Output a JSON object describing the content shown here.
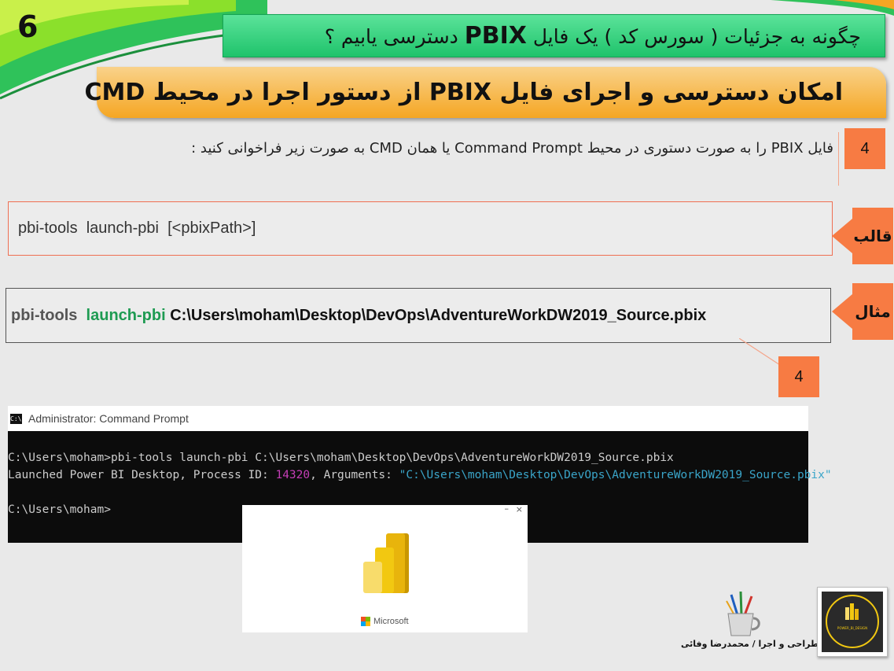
{
  "slide_number": "6",
  "title": {
    "prefix": "چگونه به جزئیات ( سورس کد ) یک فایل ",
    "emphasis": "PBIX",
    "suffix": " دسترسی یابیم ؟"
  },
  "subtitle": "امکان دسترسی و اجرای فایل PBIX از دستور اجرا در محیط CMD",
  "instruction": "فایل PBIX را به صورت دستوری در محیط  Command Prompt یا همان CMD به صورت زیر فراخوانی کنید :",
  "step_badge_top": "4",
  "step_badge_bottom": "4",
  "template": {
    "label": "قالب",
    "code": "pbi-tools  launch-pbi  [<pbixPath>]"
  },
  "example": {
    "label": "مثال",
    "tool": "pbi-tools  ",
    "command": "launch-pbi ",
    "path": "C:\\Users\\moham\\Desktop\\DevOps\\AdventureWorkDW2019_Source.pbix"
  },
  "cmd": {
    "window_title": "Administrator: Command Prompt",
    "line1": "C:\\Users\\moham>pbi-tools launch-pbi C:\\Users\\moham\\Desktop\\DevOps\\AdventureWorkDW2019_Source.pbix",
    "line2_prefix": "Launched Power BI Desktop, Process ID: ",
    "line2_pid": "14320",
    "line2_mid": ", Arguments: ",
    "line2_args": "\"C:\\Users\\moham\\Desktop\\DevOps\\AdventureWorkDW2019_Source.pbix\"",
    "line3": "C:\\Users\\moham>"
  },
  "splash": {
    "minimize": "–",
    "close": "×",
    "brand": "Microsoft"
  },
  "credit": "طراحی و اجرا / محمدرضا وفائی",
  "brand_card_text": "POWER_BI_DESIGN",
  "colors": {
    "green_title": "#1fc36b",
    "orange_subtitle": "#f5a623",
    "orange_callout": "#f77b43",
    "powerbi_yellow": "#f2c811"
  }
}
